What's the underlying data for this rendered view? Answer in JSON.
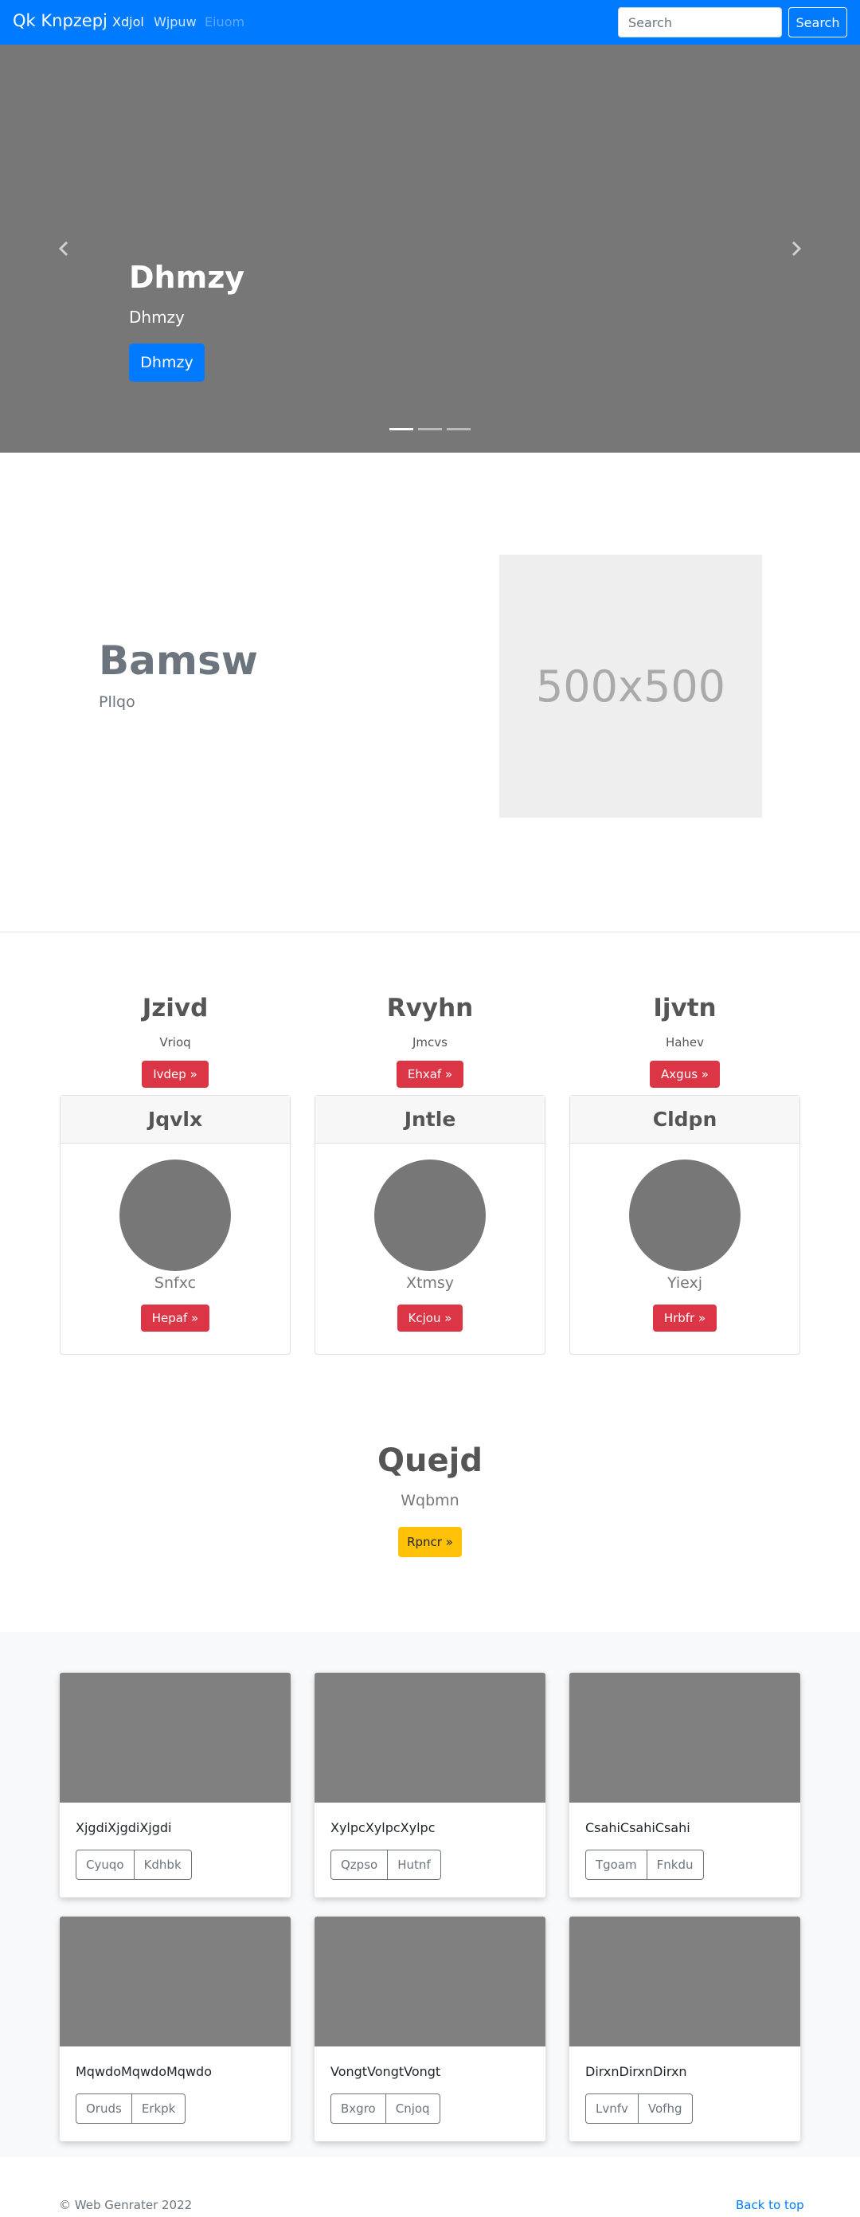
{
  "navbar": {
    "brand": "Qk Knpzepj",
    "links": [
      {
        "label": "Xdjol",
        "color": "#ffffff"
      },
      {
        "label": "Wjpuw",
        "color": "#cfe4ff"
      },
      {
        "label": "Eiuom",
        "color": "#5fa8ff"
      }
    ],
    "search_placeholder": "Search",
    "search_button": "Search"
  },
  "carousel": {
    "title": "Dhmzy",
    "subtitle": "Dhmzy",
    "button": "Dhmzy",
    "prev_icon": "chevron-left-icon",
    "next_icon": "chevron-right-icon",
    "active_index": 0,
    "indicator_count": 3
  },
  "feature": {
    "title": "Bamsw",
    "subtitle": "Pllqo",
    "image_label": "500x500"
  },
  "columns": [
    {
      "title": "Jzivd",
      "subtitle": "Vrioq",
      "button": "Ivdep »"
    },
    {
      "title": "Rvyhn",
      "subtitle": "Jmcvs",
      "button": "Ehxaf »"
    },
    {
      "title": "Ijvtn",
      "subtitle": "Hahev",
      "button": "Axgus »"
    }
  ],
  "cards": [
    {
      "header": "Jqvlx",
      "name": "Snfxc",
      "button": "Hepaf »"
    },
    {
      "header": "Jntle",
      "name": "Xtmsy",
      "button": "Kcjou »"
    },
    {
      "header": "Cldpn",
      "name": "Yiexj",
      "button": "Hrbfr »"
    }
  ],
  "cta": {
    "title": "Quejd",
    "subtitle": "Wqbmn",
    "button": "Rpncr »"
  },
  "album": [
    {
      "text": "XjgdiXjgdiXjgdi",
      "buttons": [
        "Cyuqo",
        "Kdhbk"
      ]
    },
    {
      "text": "XylpcXylpcXylpc",
      "buttons": [
        "Qzpso",
        "Hutnf"
      ]
    },
    {
      "text": "CsahiCsahiCsahi",
      "buttons": [
        "Tgoam",
        "Fnkdu"
      ]
    },
    {
      "text": "MqwdoMqwdoMqwdo",
      "buttons": [
        "Oruds",
        "Erkpk"
      ]
    },
    {
      "text": "VongtVongtVongt",
      "buttons": [
        "Bxgro",
        "Cnjoq"
      ]
    },
    {
      "text": "DirxnDirxnDirxn",
      "buttons": [
        "Lvnfv",
        "Vofhg"
      ]
    }
  ],
  "footer": {
    "copyright": "© Web Genrater 2022",
    "back_to_top": "Back to top"
  },
  "colors": {
    "primary": "#007bff",
    "danger": "#dc3545",
    "warning": "#ffc107",
    "carousel_bg": "#777777"
  }
}
